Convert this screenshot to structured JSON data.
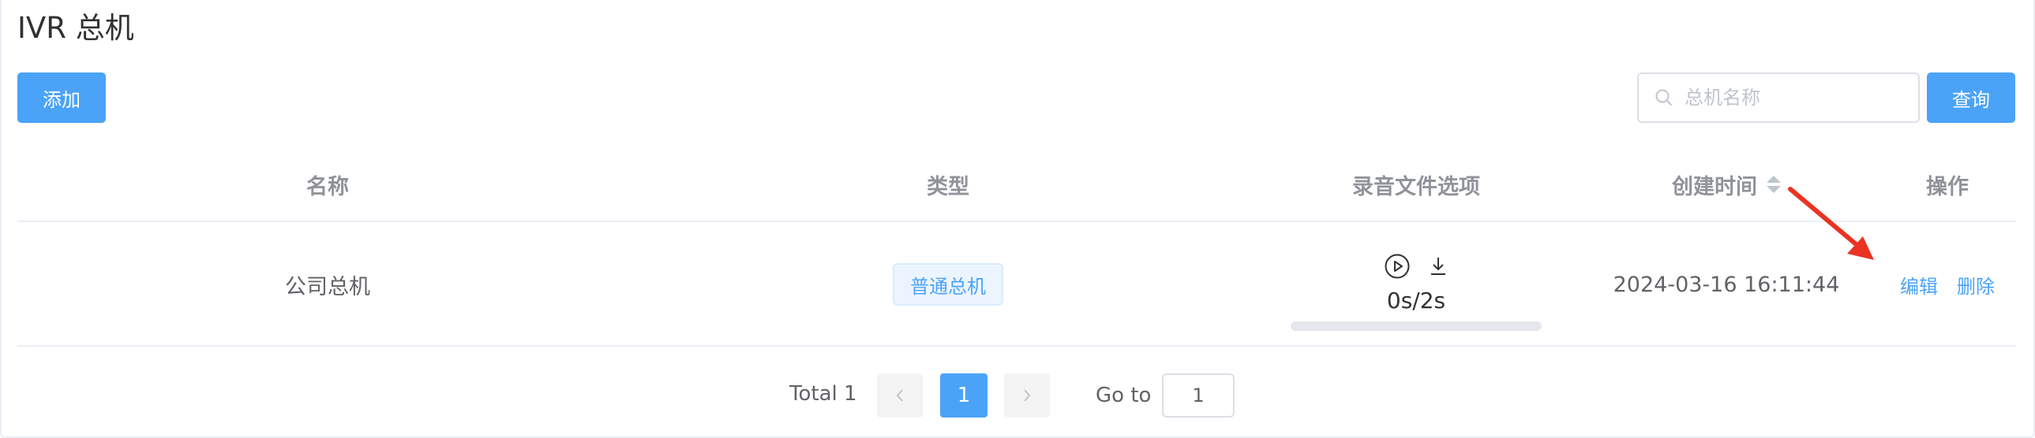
{
  "page": {
    "title": "IVR 总机"
  },
  "toolbar": {
    "add_label": "添加",
    "search_placeholder": "总机名称",
    "search_value": "",
    "query_label": "查询"
  },
  "table": {
    "columns": [
      "名称",
      "类型",
      "录音文件选项",
      "创建时间",
      "操作"
    ],
    "rows": [
      {
        "name": "公司总机",
        "type": "普通总机",
        "recording": {
          "time": "0s/2s",
          "progress": 0
        },
        "created_at": "2024-03-16 16:11:44",
        "actions": {
          "edit": "编辑",
          "delete": "删除"
        }
      }
    ]
  },
  "pagination": {
    "total_label": "Total 1",
    "current_page": "1",
    "goto_label": "Go to",
    "goto_value": "1"
  },
  "colors": {
    "primary": "#4ba3f8",
    "annotation_arrow": "#ea3323"
  },
  "icons": [
    "search-icon",
    "sort-icon",
    "play-icon",
    "download-icon",
    "chevron-left-icon",
    "chevron-right-icon",
    "annotation-arrow"
  ]
}
